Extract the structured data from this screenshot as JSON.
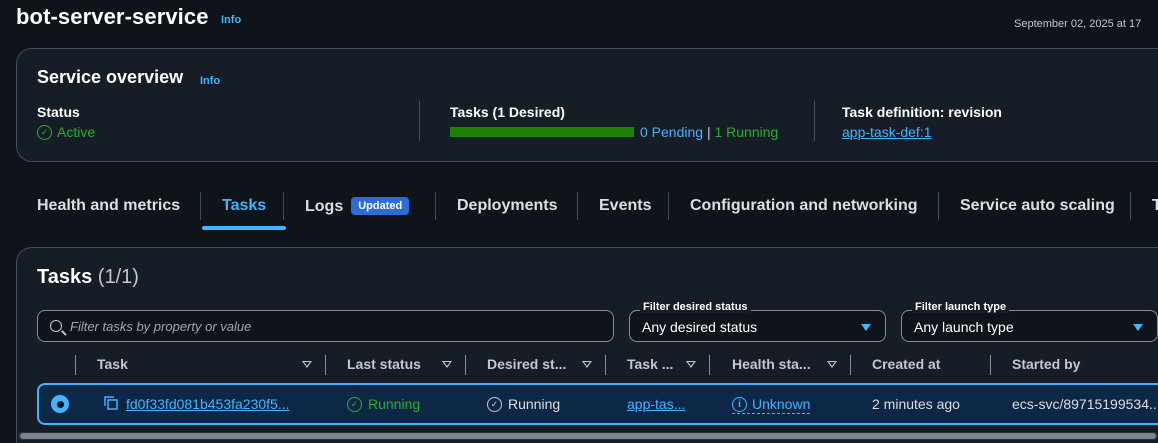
{
  "header": {
    "title": "bot-server-service",
    "info": "Info",
    "timestamp": "September 02, 2025 at 17"
  },
  "overview": {
    "title": "Service overview",
    "info": "Info",
    "status_label": "Status",
    "status_value": "Active",
    "tasks_label": "Tasks (1 Desired)",
    "tasks_progress_fraction": 1.0,
    "pending_text": "0 Pending",
    "separator": "|",
    "running_text": "1 Running",
    "taskdef_label": "Task definition: revision",
    "taskdef_value": "app-task-def:1"
  },
  "tabs": [
    {
      "label": "Health and metrics",
      "active": false
    },
    {
      "label": "Tasks",
      "active": true
    },
    {
      "label": "Logs",
      "badge": "Updated",
      "active": false
    },
    {
      "label": "Deployments",
      "active": false
    },
    {
      "label": "Events",
      "active": false
    },
    {
      "label": "Configuration and networking",
      "active": false
    },
    {
      "label": "Service auto scaling",
      "active": false
    },
    {
      "label": "T",
      "active": false
    }
  ],
  "tasks_panel": {
    "title": "Tasks",
    "count": "(1/1)",
    "search_placeholder": "Filter tasks by property or value",
    "filter_desired_label": "Filter desired status",
    "filter_desired_value": "Any desired status",
    "filter_launch_label": "Filter launch type",
    "filter_launch_value": "Any launch type",
    "columns": [
      "Task",
      "Last status",
      "Desired st...",
      "Task ...",
      "Health sta...",
      "Created at",
      "Started by"
    ],
    "rows": [
      {
        "task": "fd0f33fd081b453fa230f5...",
        "last_status": "Running",
        "desired_status": "Running",
        "task_def": "app-tas...",
        "health": "Unknown",
        "created": "2 minutes ago",
        "started_by": "ecs-svc/89715199534..."
      }
    ]
  },
  "colors": {
    "accent": "#42b4ff",
    "success": "#29ad32",
    "background": "#0f141a",
    "panel": "#161d26",
    "badge": "#2a6dd8"
  }
}
